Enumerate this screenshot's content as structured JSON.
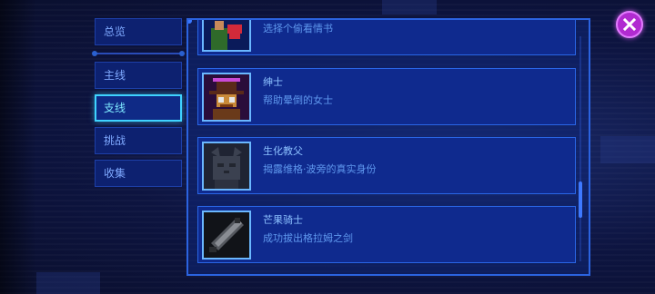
{
  "sidebar": {
    "overview": "总览",
    "items": [
      {
        "label": "主线",
        "active": false
      },
      {
        "label": "支线",
        "active": true
      },
      {
        "label": "挑战",
        "active": false
      },
      {
        "label": "收集",
        "active": false
      }
    ]
  },
  "quests": [
    {
      "title": "",
      "desc": "选择个偷看情书",
      "icon": "lover-letter-icon"
    },
    {
      "title": "绅士",
      "desc": "帮助晕倒的女士",
      "icon": "gentleman-icon"
    },
    {
      "title": "生化教父",
      "desc": "揭露维格·波旁的真实身份",
      "icon": "cat-godfather-icon"
    },
    {
      "title": "芒果骑士",
      "desc": "成功拔出格拉姆之剑",
      "icon": "sword-icon"
    }
  ],
  "colors": {
    "accent": "#3fd3ff",
    "panel": "#0f2a8e",
    "close": "#b12bd1"
  }
}
